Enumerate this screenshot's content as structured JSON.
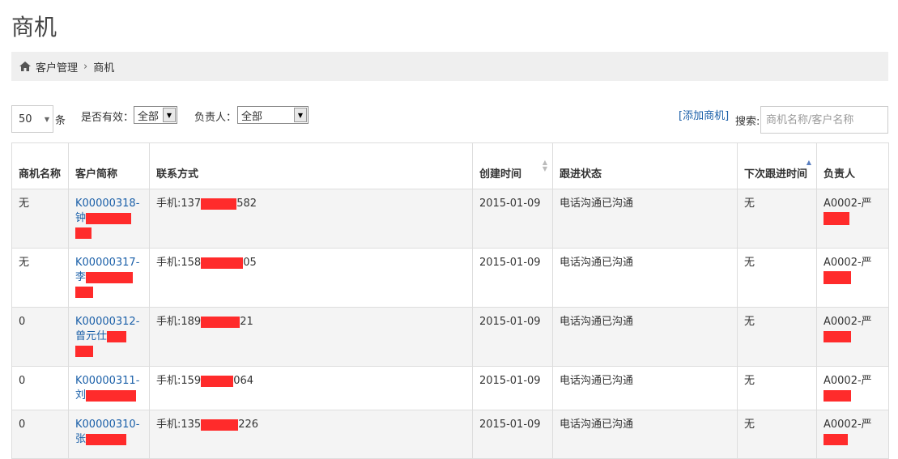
{
  "page": {
    "title": "商机"
  },
  "breadcrumb": {
    "parent": "客户管理",
    "current": "商机",
    "separator": "›"
  },
  "toolbar": {
    "page_length": "50",
    "page_length_unit": "条",
    "valid_label": "是否有效：",
    "valid_value": "全部",
    "owner_label": "负责人：",
    "owner_value": "全部",
    "add_link": "[添加商机]",
    "search_label": "搜索:",
    "search_placeholder": "商机名称/客户名称"
  },
  "table": {
    "headers": [
      "商机名称",
      "客户简称",
      "联系方式",
      "创建时间",
      "跟进状态",
      "下次跟进时间",
      "负责人"
    ],
    "rows": [
      {
        "name": "无",
        "customer": "K00000318-钟",
        "phone_prefix": "手机:137",
        "phone_suffix": "582",
        "created": "2015-01-09",
        "status": "电话沟通已沟通",
        "next": "无",
        "owner": "A0002-严"
      },
      {
        "name": "无",
        "customer": "K00000317-李",
        "phone_prefix": "手机:158",
        "phone_suffix": "05",
        "created": "2015-01-09",
        "status": "电话沟通已沟通",
        "next": "无",
        "owner": "A0002-严"
      },
      {
        "name": "0",
        "customer": "K00000312-曾元仕",
        "phone_prefix": "手机:189",
        "phone_suffix": "21",
        "created": "2015-01-09",
        "status": "电话沟通已沟通",
        "next": "无",
        "owner": "A0002-严"
      },
      {
        "name": "0",
        "customer": "K00000311-刘",
        "phone_prefix": "手机:159",
        "phone_suffix": "064",
        "created": "2015-01-09",
        "status": "电话沟通已沟通",
        "next": "无",
        "owner": "A0002-严"
      },
      {
        "name": "0",
        "customer": "K00000310-张",
        "phone_prefix": "手机:135",
        "phone_suffix": "226",
        "created": "2015-01-09",
        "status": "电话沟通已沟通",
        "next": "无",
        "owner": "A0002-严"
      }
    ]
  },
  "colors": {
    "link": "#1a5fa8",
    "redaction": "#ff2b2b",
    "stripe": "#f4f4f4"
  }
}
